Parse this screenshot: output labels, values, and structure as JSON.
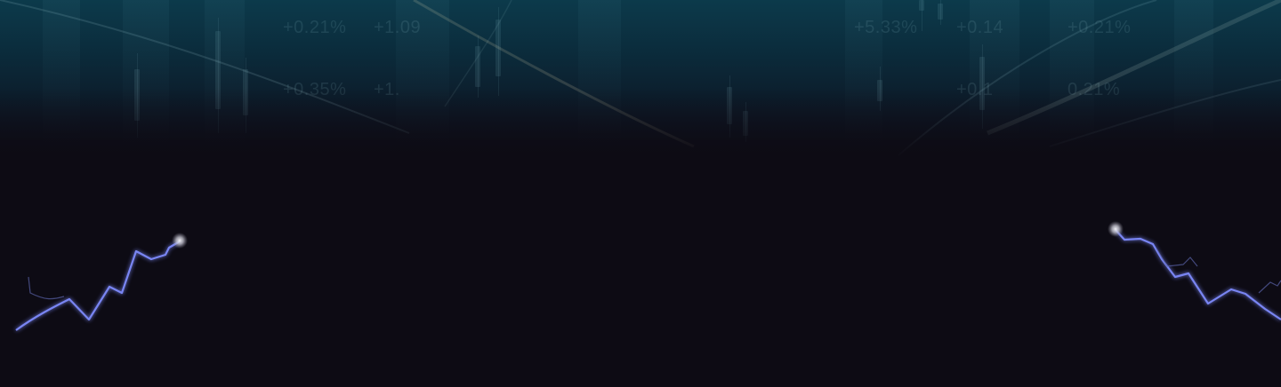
{
  "hero": {
    "ticker_labels": [
      "+0.21%",
      "+1.09",
      "+0.35%",
      "+1.",
      "+5.33%",
      "+0.14",
      "+0.21%",
      "+0.1",
      "0.21%"
    ]
  },
  "colors": {
    "page_background": "#0d0b14",
    "banner_top": "#0c3a4b",
    "spark_line": "#7f8cff",
    "glow_dot": "#d8d8e0"
  }
}
